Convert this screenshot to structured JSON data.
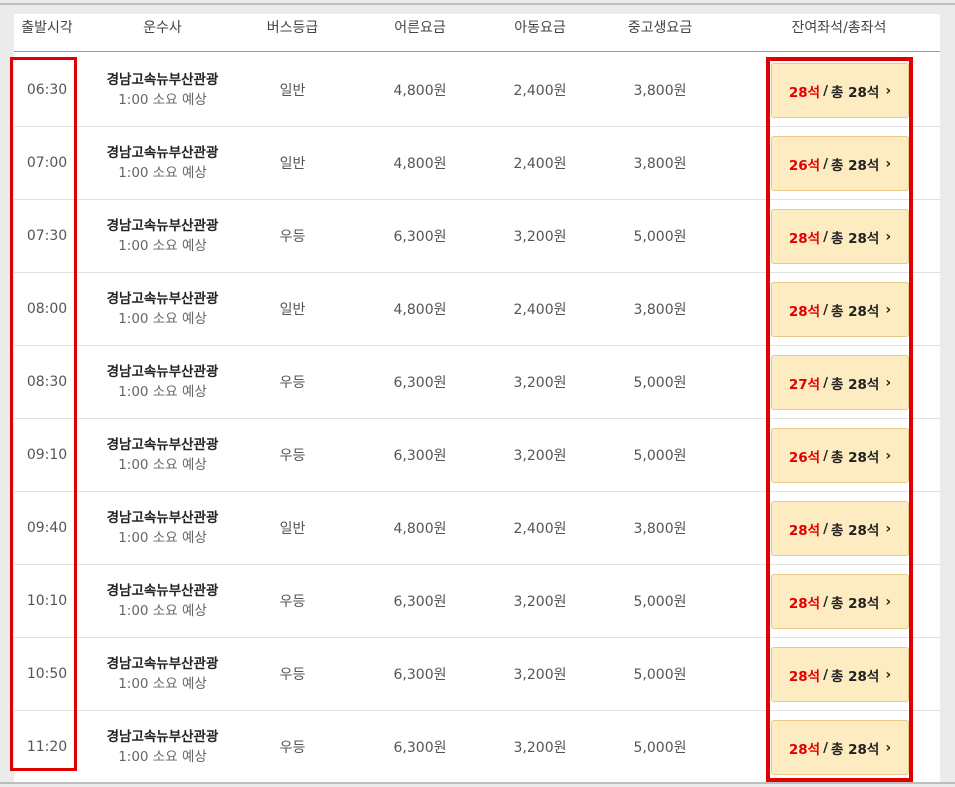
{
  "headers": {
    "departure": "출발시각",
    "company": "운수사",
    "grade": "버스등급",
    "adult": "어른요금",
    "child": "아동요금",
    "student": "중고생요금",
    "seats": "잔여좌석/총좌석"
  },
  "rows": [
    {
      "time": "06:30",
      "company": "경남고속뉴부산관광",
      "duration": "1:00 소요 예상",
      "grade": "일반",
      "adult": "4,800원",
      "child": "2,400원",
      "student": "3,800원",
      "remain": "28석",
      "total": "총 28석"
    },
    {
      "time": "07:00",
      "company": "경남고속뉴부산관광",
      "duration": "1:00 소요 예상",
      "grade": "일반",
      "adult": "4,800원",
      "child": "2,400원",
      "student": "3,800원",
      "remain": "26석",
      "total": "총 28석"
    },
    {
      "time": "07:30",
      "company": "경남고속뉴부산관광",
      "duration": "1:00 소요 예상",
      "grade": "우등",
      "adult": "6,300원",
      "child": "3,200원",
      "student": "5,000원",
      "remain": "28석",
      "total": "총 28석"
    },
    {
      "time": "08:00",
      "company": "경남고속뉴부산관광",
      "duration": "1:00 소요 예상",
      "grade": "일반",
      "adult": "4,800원",
      "child": "2,400원",
      "student": "3,800원",
      "remain": "28석",
      "total": "총 28석"
    },
    {
      "time": "08:30",
      "company": "경남고속뉴부산관광",
      "duration": "1:00 소요 예상",
      "grade": "우등",
      "adult": "6,300원",
      "child": "3,200원",
      "student": "5,000원",
      "remain": "27석",
      "total": "총 28석"
    },
    {
      "time": "09:10",
      "company": "경남고속뉴부산관광",
      "duration": "1:00 소요 예상",
      "grade": "우등",
      "adult": "6,300원",
      "child": "3,200원",
      "student": "5,000원",
      "remain": "26석",
      "total": "총 28석"
    },
    {
      "time": "09:40",
      "company": "경남고속뉴부산관광",
      "duration": "1:00 소요 예상",
      "grade": "일반",
      "adult": "4,800원",
      "child": "2,400원",
      "student": "3,800원",
      "remain": "28석",
      "total": "총 28석"
    },
    {
      "time": "10:10",
      "company": "경남고속뉴부산관광",
      "duration": "1:00 소요 예상",
      "grade": "우등",
      "adult": "6,300원",
      "child": "3,200원",
      "student": "5,000원",
      "remain": "28석",
      "total": "총 28석"
    },
    {
      "time": "10:50",
      "company": "경남고속뉴부산관광",
      "duration": "1:00 소요 예상",
      "grade": "우등",
      "adult": "6,300원",
      "child": "3,200원",
      "student": "5,000원",
      "remain": "28석",
      "total": "총 28석"
    },
    {
      "time": "11:20",
      "company": "경남고속뉴부산관광",
      "duration": "1:00 소요 예상",
      "grade": "우등",
      "adult": "6,300원",
      "child": "3,200원",
      "student": "5,000원",
      "remain": "28석",
      "total": "총 28석"
    }
  ],
  "seat_separator": "/",
  "chevron_icon": "chevron-right-icon",
  "colors": {
    "remain": "#e00000",
    "highlight": "#e00000",
    "button_bg": "#fdebc1"
  }
}
